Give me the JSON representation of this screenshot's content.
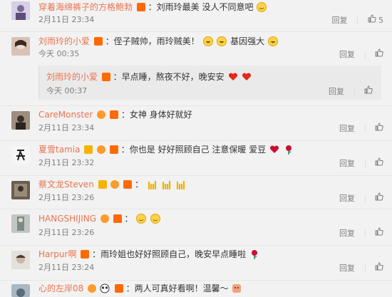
{
  "comments": [
    {
      "username": "穿着海绵裤子的方格鲍勃",
      "text": "：刘雨玲最美 没人不同意吧",
      "time": "2月11日 23:34",
      "reply_label": "回复",
      "like_count": "5"
    },
    {
      "username": "刘雨玲的小爱",
      "text": "：侄子贼帅，雨玲贼美！",
      "text_after": "基因强大",
      "time": "今天 00:35",
      "reply_label": "回复",
      "like_count": "",
      "nested_reply": {
        "username": "刘雨玲的小爱",
        "text": "：早点睡，熬夜不好，晚安安",
        "time": "今天 00:37",
        "reply_label": "回复",
        "like_count": ""
      }
    },
    {
      "username": "CareMonster",
      "text": "：女神 身体好就好",
      "time": "2月11日 23:34",
      "reply_label": "回复",
      "like_count": ""
    },
    {
      "username": "夏雪tamia",
      "text": "：你也是 好好照顾自己 注意保暖 爱豆",
      "time": "2月11日 23:32",
      "reply_label": "回复",
      "like_count": ""
    },
    {
      "username": "蔡文龙Steven",
      "text": "：",
      "time": "2月11日 23:26",
      "reply_label": "回复",
      "like_count": ""
    },
    {
      "username": "HANGSHIJING",
      "text": "：",
      "time": "2月11日 23:26",
      "reply_label": "回复",
      "like_count": ""
    },
    {
      "username": "Harpur啊",
      "text": "：雨玲姐也好好照顾自己，晚安早点睡啦",
      "time": "2月11日 23:24",
      "reply_label": "回复",
      "like_count": ""
    },
    {
      "username": "心的左岸08",
      "text": "：两人可真好看啊！温馨～",
      "time": "",
      "reply_label": "",
      "like_count": ""
    }
  ],
  "colors": {
    "username": "#eb7350",
    "meta": "#808080",
    "background": "#f2f2f2",
    "nested_background": "#eaeaea"
  }
}
